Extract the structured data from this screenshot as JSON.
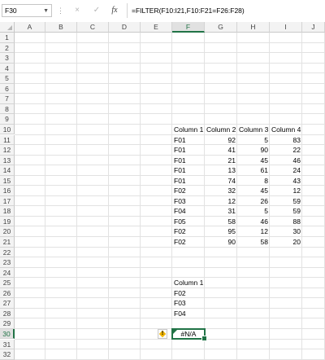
{
  "formula_bar": {
    "name_box": "F30",
    "cancel_icon": "×",
    "enter_icon": "✓",
    "fx_label": "fx",
    "formula": "=FILTER(F10:I21,F10:F21=F26:F28)"
  },
  "columns": [
    "A",
    "B",
    "C",
    "D",
    "E",
    "F",
    "G",
    "H",
    "I",
    "J"
  ],
  "active_column": "F",
  "rows": [
    "1",
    "2",
    "3",
    "4",
    "5",
    "6",
    "7",
    "8",
    "9",
    "10",
    "11",
    "12",
    "13",
    "14",
    "15",
    "16",
    "17",
    "18",
    "19",
    "20",
    "21",
    "22",
    "23",
    "24",
    "25",
    "26",
    "27",
    "28",
    "29",
    "30",
    "31",
    "32"
  ],
  "active_row": "30",
  "table": {
    "headers": [
      "Column 1",
      "Column 2",
      "Column 3",
      "Column 4"
    ],
    "rows": [
      [
        "F01",
        "92",
        "5",
        "83"
      ],
      [
        "F01",
        "41",
        "90",
        "22"
      ],
      [
        "F01",
        "21",
        "45",
        "46"
      ],
      [
        "F01",
        "13",
        "61",
        "24"
      ],
      [
        "F01",
        "74",
        "8",
        "43"
      ],
      [
        "F02",
        "32",
        "45",
        "12"
      ],
      [
        "F03",
        "12",
        "26",
        "59"
      ],
      [
        "F04",
        "31",
        "5",
        "59"
      ],
      [
        "F05",
        "58",
        "46",
        "88"
      ],
      [
        "F02",
        "95",
        "12",
        "30"
      ],
      [
        "F02",
        "90",
        "58",
        "20"
      ]
    ]
  },
  "criteria": {
    "header": "Column 1",
    "values": [
      "F02",
      "F03",
      "F04"
    ]
  },
  "result_cell": {
    "value": "#N/A",
    "warning_glyph": "!"
  },
  "colors": {
    "accent": "#217346",
    "warning": "#f0b400"
  }
}
